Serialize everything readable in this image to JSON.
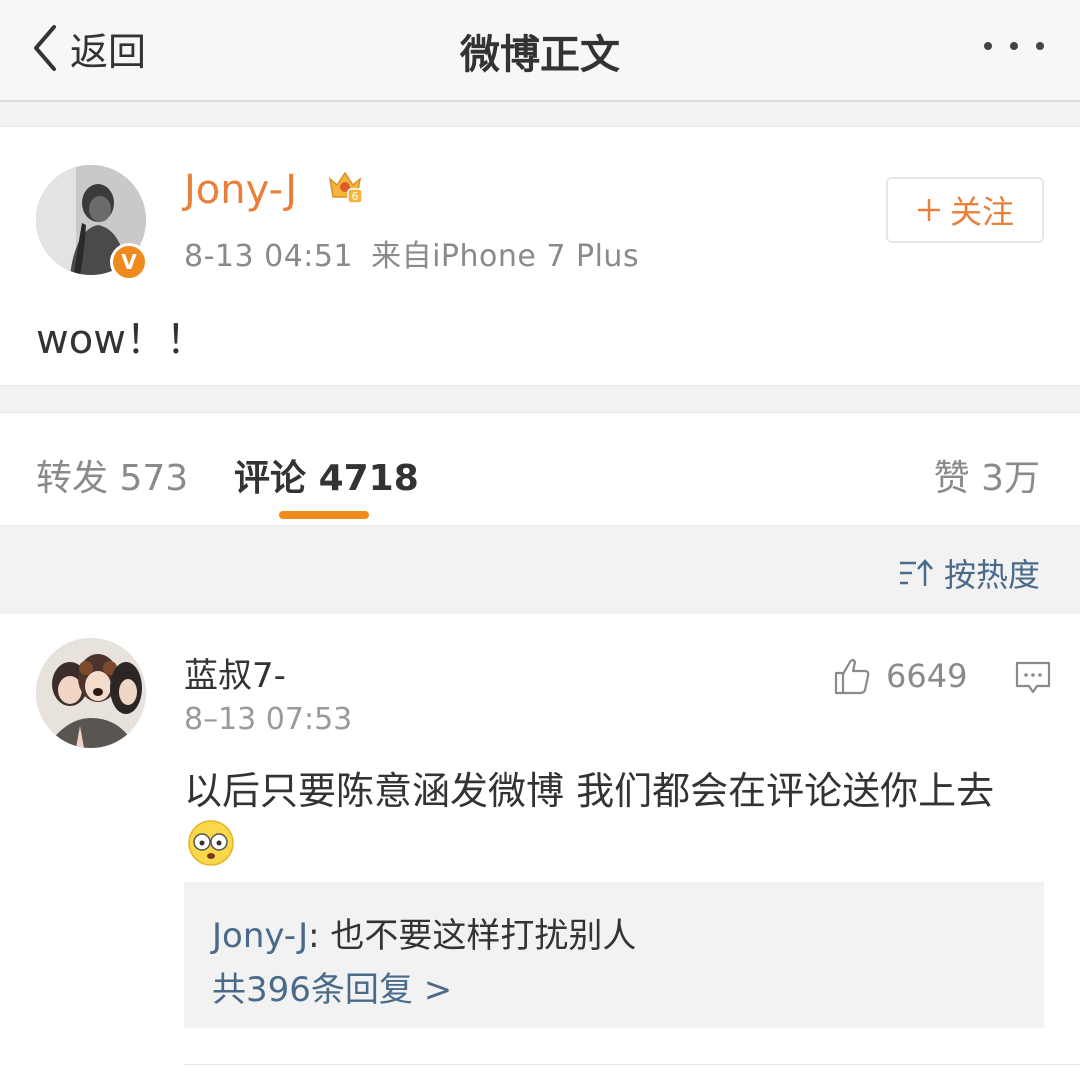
{
  "nav": {
    "back_label": "返回",
    "title": "微博正文",
    "more_icon": "more-dots-icon"
  },
  "post": {
    "author": "Jony-J",
    "verified_badge": "V",
    "vip_level": "6",
    "time": "8-13 04:51",
    "source": "来自iPhone 7 Plus",
    "follow_label": "关注",
    "text": "wow！！"
  },
  "tabs": {
    "repost_label": "转发",
    "repost_count": "573",
    "comment_label": "评论",
    "comment_count": "4718",
    "like_label": "赞",
    "like_count": "3万"
  },
  "sort": {
    "label": "按热度",
    "icon": "sort-icon"
  },
  "comment": {
    "author": "蓝叔7-",
    "time": "8–13 07:53",
    "likes": "6649",
    "text": "以后只要陈意涵发微博 我们都会在评论送你上去",
    "emoji": "shocked-face-emoji",
    "reply": {
      "author": "Jony-J",
      "separator": ":",
      "text": " 也不要这样打扰别人",
      "more_label": "共396条回复 >"
    }
  },
  "colors": {
    "accent_orange": "#e8803a",
    "link_blue": "#4a6a8a",
    "muted_gray": "#8a8a8a"
  }
}
